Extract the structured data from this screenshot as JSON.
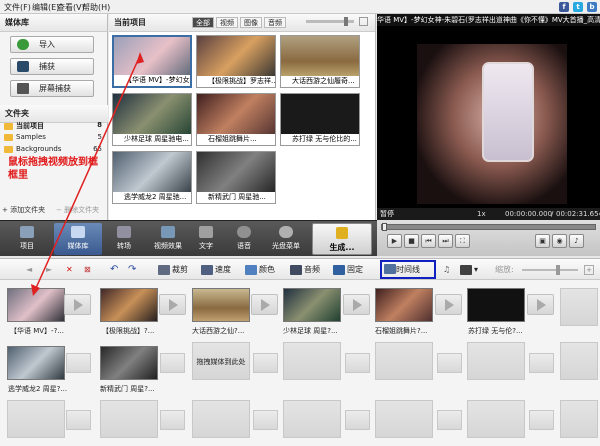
{
  "menu": {
    "file": "文件(F)",
    "edit": "编辑(E)",
    "view": "查看(V)",
    "help": "帮助(H)",
    "social": [
      "f",
      "t",
      "b"
    ]
  },
  "library": {
    "title": "媒体库",
    "import": "导入",
    "capture": "捕获",
    "screen_capture": "屏幕捕获",
    "folders_title": "文件夹",
    "tree": [
      {
        "label": "当前项目",
        "count": "8"
      },
      {
        "label": "Samples",
        "count": "5"
      },
      {
        "label": "Backgrounds",
        "count": "65"
      }
    ],
    "annotation": "鼠标拖拽视频放到框框里",
    "add_folder": "添加文件夹",
    "delete_folder": "删除文件夹"
  },
  "grid": {
    "title": "当前项目",
    "tabs": [
      "全部",
      "视频",
      "图像",
      "音频"
    ],
    "items": [
      {
        "label": "【华语 MV】-梦幻女神..."
      },
      {
        "label": "【极限挑战】罗志祥..."
      },
      {
        "label": "大话西游之仙履奇..."
      },
      {
        "label": "少林足球 周星驰电..."
      },
      {
        "label": "石榴姐跳舞片..."
      },
      {
        "label": "苏打绿 无与伦比的..."
      },
      {
        "label": "逃学威龙2 周星驰..."
      },
      {
        "label": "新精武门 周星驰..."
      }
    ]
  },
  "player": {
    "title": "华语 MV】-梦幻女神-朱碧石(罗志祥出道神曲《你不懂》MV大首播_高清",
    "pause": "暂停",
    "speed": "1x",
    "current": "00:00:00.000",
    "total": "00:02:31.654"
  },
  "toolbar": {
    "items": [
      "项目",
      "媒体库",
      "转场",
      "视频效果",
      "文字",
      "语音",
      "光盘菜单",
      "生成..."
    ]
  },
  "edit": {
    "crop": "裁剪",
    "speed": "速度",
    "color": "颜色",
    "audio": "音频",
    "pin": "固定",
    "timeline": "时间线",
    "zoom": "缩放:"
  },
  "story": {
    "row1": [
      "【华语 MV】-?...",
      "【极限挑战】?...",
      "大话西游之仙?...",
      "少林足球 周星?...",
      "石榴姐跳舞片?...",
      "苏打绿 无与伦?..."
    ],
    "row2": [
      "逃学威龙2 周星?...",
      "新精武门 周星?..."
    ],
    "drop_here": "拖拽媒体到此处"
  },
  "colors": {
    "accent": "#3a6ea5",
    "highlight_box": "#1020c0",
    "arrow": "#e02020"
  }
}
